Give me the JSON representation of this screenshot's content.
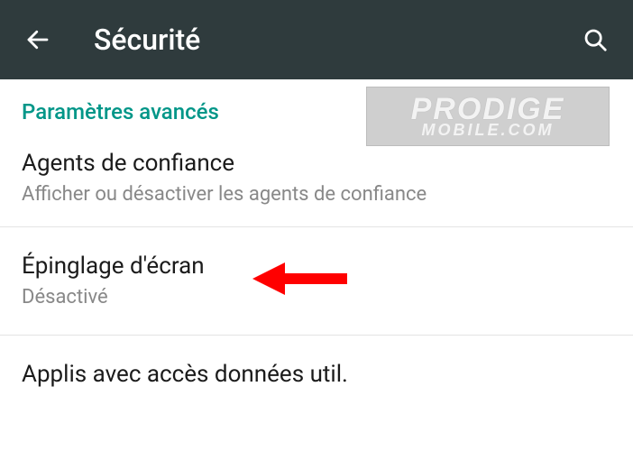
{
  "appbar": {
    "title": "Sécurité",
    "back_icon": "back-arrow",
    "search_icon": "search"
  },
  "section": {
    "header": "Paramètres avancés"
  },
  "items": {
    "trust_agents": {
      "title": "Agents de confiance",
      "subtitle": "Afficher ou désactiver les agents de confiance"
    },
    "screen_pinning": {
      "title": "Épinglage d'écran",
      "subtitle": "Désactivé"
    },
    "apps_usage": {
      "title": "Applis avec accès données util."
    }
  },
  "watermark": {
    "line1": "PRODIGE",
    "line2": "MOBILE.COM"
  }
}
